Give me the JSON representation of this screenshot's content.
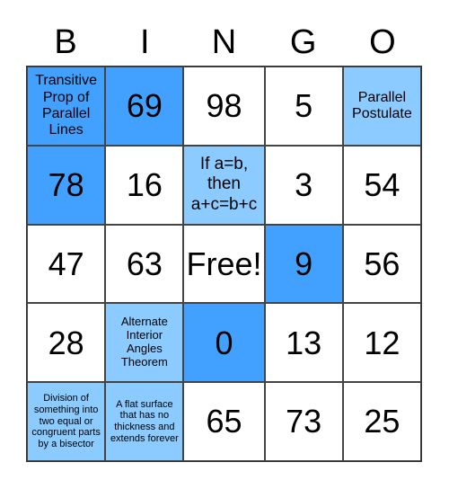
{
  "header": [
    "B",
    "I",
    "N",
    "G",
    "O"
  ],
  "colors": {
    "marked_dark": "#42a0ff",
    "marked_light": "#8ccbff",
    "unmarked": "#ffffff"
  },
  "cells": [
    {
      "text": "Transitive Prop of Parallel Lines",
      "state": "dark",
      "size": "t1"
    },
    {
      "text": "69",
      "state": "dark",
      "size": "n"
    },
    {
      "text": "98",
      "state": "white",
      "size": "n"
    },
    {
      "text": "5",
      "state": "white",
      "size": "n"
    },
    {
      "text": "Parallel Postulate",
      "state": "light",
      "size": "t1"
    },
    {
      "text": "78",
      "state": "dark",
      "size": "n"
    },
    {
      "text": "16",
      "state": "white",
      "size": "n"
    },
    {
      "text": "If a=b, then a+c=b+c",
      "state": "light",
      "size": "t2"
    },
    {
      "text": "3",
      "state": "white",
      "size": "n"
    },
    {
      "text": "54",
      "state": "white",
      "size": "n"
    },
    {
      "text": "47",
      "state": "white",
      "size": "n"
    },
    {
      "text": "63",
      "state": "white",
      "size": "n"
    },
    {
      "text": "Free!",
      "state": "white",
      "size": "n"
    },
    {
      "text": "9",
      "state": "dark",
      "size": "n"
    },
    {
      "text": "56",
      "state": "white",
      "size": "n"
    },
    {
      "text": "28",
      "state": "white",
      "size": "n"
    },
    {
      "text": "Alternate Interior Angles Theorem",
      "state": "light",
      "size": "t3"
    },
    {
      "text": "0",
      "state": "dark",
      "size": "n"
    },
    {
      "text": "13",
      "state": "white",
      "size": "n"
    },
    {
      "text": "12",
      "state": "white",
      "size": "n"
    },
    {
      "text": "Division of something into two equal or congruent parts by a bisector",
      "state": "light",
      "size": "t4"
    },
    {
      "text": "A flat surface that has no thickness and extends forever",
      "state": "light",
      "size": "t4"
    },
    {
      "text": "65",
      "state": "white",
      "size": "n"
    },
    {
      "text": "73",
      "state": "white",
      "size": "n"
    },
    {
      "text": "25",
      "state": "white",
      "size": "n"
    }
  ]
}
